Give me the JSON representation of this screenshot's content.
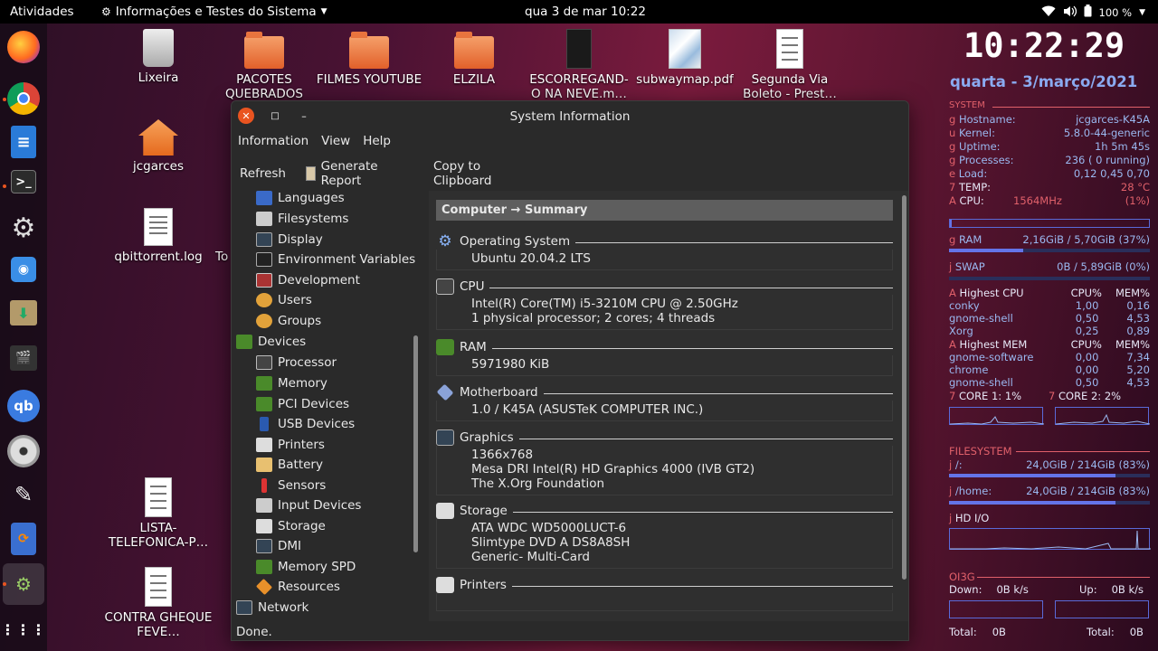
{
  "topbar": {
    "activities": "Atividades",
    "app_menu": "Informações e Testes do Sistema",
    "clock": "qua 3 de mar  10:22",
    "battery": "100 %"
  },
  "desktop": {
    "icons": [
      {
        "label": "Lixeira"
      },
      {
        "label": "PACOTES QUEBRADOS"
      },
      {
        "label": "FILMES YOUTUBE"
      },
      {
        "label": "ELZILA"
      },
      {
        "label": "ESCORREGAND-O NA NEVE.m…"
      },
      {
        "label": "subwaymap.pdf"
      },
      {
        "label": "Segunda Via Boleto - Prest…"
      },
      {
        "label": "jcgarces"
      },
      {
        "label": "qbittorrent.log"
      },
      {
        "label": "To"
      },
      {
        "label": "LISTA-TELEFONICA-P…"
      },
      {
        "label": "CONTRA GHEQUE FEVE…"
      }
    ]
  },
  "window": {
    "title": "System Information",
    "menu": [
      "Information",
      "View",
      "Help"
    ],
    "toolbar": {
      "refresh": "Refresh",
      "report": "Generate Report",
      "copy": "Copy to Clipboard"
    },
    "sidebar": [
      {
        "label": "Languages",
        "icon": "flag-icon"
      },
      {
        "label": "Filesystems",
        "icon": "drive-icon"
      },
      {
        "label": "Display",
        "icon": "monitor-icon"
      },
      {
        "label": "Environment Variables",
        "icon": "terminal-icon"
      },
      {
        "label": "Development",
        "icon": "development-icon"
      },
      {
        "label": "Users",
        "icon": "users-icon"
      },
      {
        "label": "Groups",
        "icon": "groups-icon"
      },
      {
        "label": "Devices",
        "icon": "board-icon"
      },
      {
        "label": "Processor",
        "icon": "chip-icon"
      },
      {
        "label": "Memory",
        "icon": "memory-icon"
      },
      {
        "label": "PCI Devices",
        "icon": "pci-icon"
      },
      {
        "label": "USB Devices",
        "icon": "usb-icon"
      },
      {
        "label": "Printers",
        "icon": "printer-icon"
      },
      {
        "label": "Battery",
        "icon": "battery-icon"
      },
      {
        "label": "Sensors",
        "icon": "sensor-icon"
      },
      {
        "label": "Input Devices",
        "icon": "input-icon"
      },
      {
        "label": "Storage",
        "icon": "storage-icon"
      },
      {
        "label": "DMI",
        "icon": "dmi-icon"
      },
      {
        "label": "Memory SPD",
        "icon": "memory-spd-icon"
      },
      {
        "label": "Resources",
        "icon": "resources-icon"
      },
      {
        "label": "Network",
        "icon": "network-icon"
      }
    ],
    "content_header": "Computer → Summary",
    "sections": [
      {
        "title": "Operating System",
        "icon": "gear-icon",
        "lines": [
          "Ubuntu 20.04.2 LTS"
        ]
      },
      {
        "title": "CPU",
        "icon": "chip-icon",
        "lines": [
          "Intel(R) Core(TM) i5-3210M CPU @ 2.50GHz",
          "1 physical processor; 2 cores; 4 threads"
        ]
      },
      {
        "title": "RAM",
        "icon": "memory-icon",
        "lines": [
          "5971980 KiB"
        ]
      },
      {
        "title": "Motherboard",
        "icon": "motherboard-icon",
        "lines": [
          "1.0 / K45A (ASUSTeK COMPUTER INC.)"
        ]
      },
      {
        "title": "Graphics",
        "icon": "monitor-icon",
        "lines": [
          "1366x768",
          "Mesa DRI Intel(R) HD Graphics 4000 (IVB GT2)",
          "The X.Org Foundation"
        ]
      },
      {
        "title": "Storage",
        "icon": "storage-icon",
        "lines": [
          "ATA WDC WD5000LUCT-6",
          "Slimtype DVD A  DS8A8SH",
          "Generic- Multi-Card"
        ]
      },
      {
        "title": "Printers",
        "icon": "printer-icon",
        "lines": []
      }
    ],
    "status": "Done."
  },
  "conky": {
    "time": "10:22:29",
    "date": "quarta -  3/março/2021",
    "system_header": "SYSTEM",
    "system": [
      {
        "k": "Hostname:",
        "v": "jcgarces-K45A"
      },
      {
        "k": "Kernel:",
        "v": "5.8.0-44-generic"
      },
      {
        "k": "Uptime:",
        "v": "1h 5m 45s"
      },
      {
        "k": "Processes:",
        "v": "236 (   0 running)"
      },
      {
        "k": "Load:",
        "v": "0,12 0,45 0,70"
      },
      {
        "k": "TEMP:",
        "v": "28 °C"
      }
    ],
    "cpu_label": "CPU:",
    "cpu_freq": "1564MHz",
    "cpu_pct": "(1%)",
    "cpu_usage": 0.01,
    "ram_label": "RAM",
    "ram_value": "2,16GiB / 5,70GiB (37%)",
    "ram_usage": 0.37,
    "swap_label": "SWAP",
    "swap_value": "0B   / 5,89GiB (0%)",
    "swap_usage": 0.0,
    "highest_cpu_label": "Highest CPU",
    "highest_mem_label": "Highest MEM",
    "col_cpu": "CPU%",
    "col_mem": "MEM%",
    "highest_cpu": [
      {
        "name": "conky",
        "cpu": "1,00",
        "mem": "0,16"
      },
      {
        "name": "gnome-shell",
        "cpu": "0,50",
        "mem": "4,53"
      },
      {
        "name": "Xorg",
        "cpu": "0,25",
        "mem": "0,89"
      }
    ],
    "highest_mem": [
      {
        "name": "gnome-software",
        "cpu": "0,00",
        "mem": "7,34"
      },
      {
        "name": "chrome",
        "cpu": "0,00",
        "mem": "5,20"
      },
      {
        "name": "gnome-shell",
        "cpu": "0,50",
        "mem": "4,53"
      }
    ],
    "core1": "CORE 1:  1%",
    "core2": "CORE 2:  2%",
    "filesystem_header": "FILESYSTEM",
    "fs_root_label": "/:",
    "fs_root_value": "24,0GiB /  214GiB (83%)",
    "fs_root_usage": 0.83,
    "fs_home_label": "/home:",
    "fs_home_value": "24,0GiB /  214GiB (83%)",
    "fs_home_usage": 0.83,
    "hd_io": "HD  I/O",
    "net_header": "OI3G",
    "down_label": "Down:",
    "down_value": "0B   k/s",
    "up_label": "Up:",
    "up_value": "0B   k/s",
    "total_label": "Total:",
    "total_down": "0B",
    "total_up": "0B"
  },
  "colors": {
    "accent": "#e95420",
    "conky_blue": "#9ab8f0",
    "conky_red": "#e0606a",
    "close_button": "#e95420"
  }
}
